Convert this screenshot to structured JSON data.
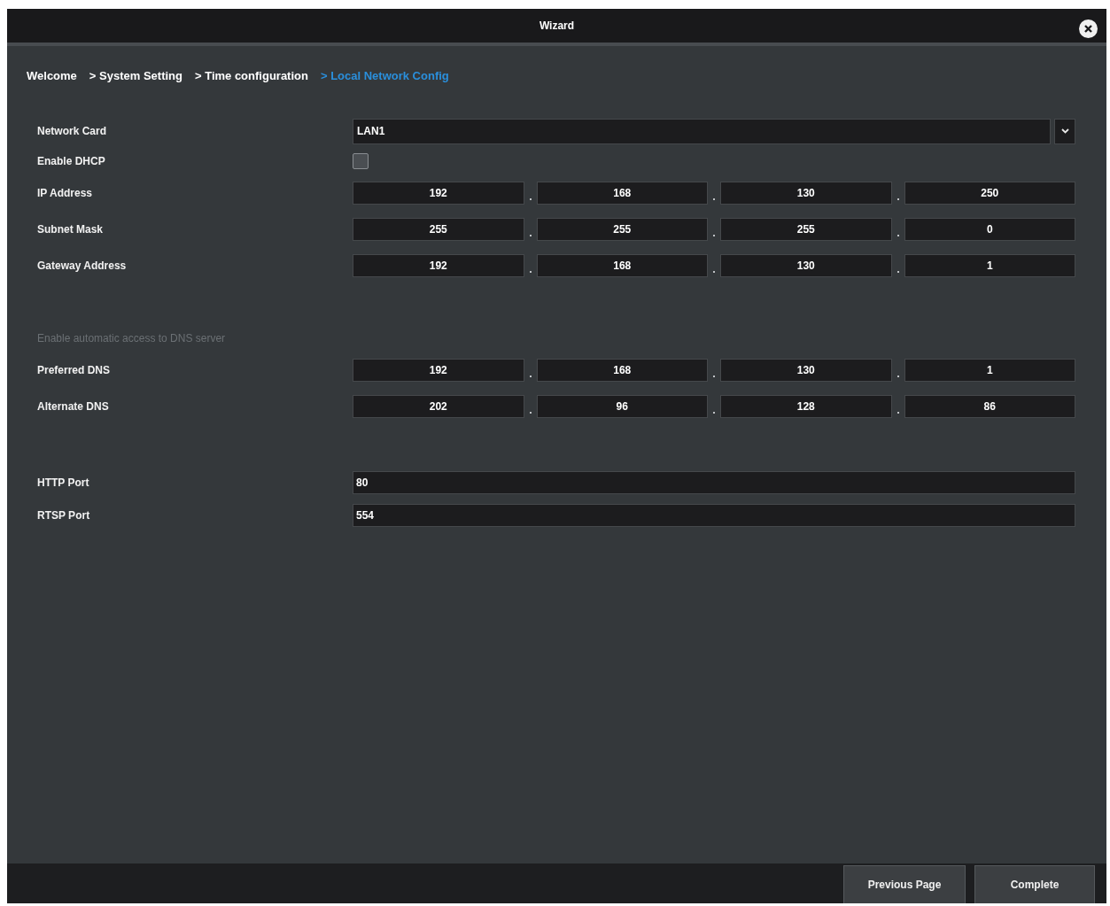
{
  "window": {
    "title": "Wizard"
  },
  "breadcrumb": [
    {
      "label": "Welcome",
      "selected": false
    },
    {
      "label": "> System Setting",
      "selected": false
    },
    {
      "label": "> Time configuration",
      "selected": false
    },
    {
      "label": "> Local Network Config",
      "selected": true
    }
  ],
  "groups": [
    {
      "rows": [
        {
          "kind": "select",
          "label": "Network Card",
          "value": "LAN1"
        },
        {
          "kind": "checkbox",
          "label": "Enable DHCP",
          "checked": false
        },
        {
          "kind": "ip",
          "label": "IP Address",
          "octets": [
            "192",
            "168",
            "130",
            "250"
          ]
        },
        {
          "kind": "ip",
          "label": "Subnet Mask",
          "octets": [
            "255",
            "255",
            "255",
            "0"
          ]
        },
        {
          "kind": "ip",
          "label": "Gateway Address",
          "octets": [
            "192",
            "168",
            "130",
            "1"
          ]
        }
      ]
    },
    {
      "rows": [
        {
          "kind": "note",
          "label": "Enable automatic access to DNS server",
          "disabled": true
        },
        {
          "kind": "ip",
          "label": "Preferred DNS",
          "octets": [
            "192",
            "168",
            "130",
            "1"
          ]
        },
        {
          "kind": "ip",
          "label": "Alternate DNS",
          "octets": [
            "202",
            "96",
            "128",
            "86"
          ]
        }
      ]
    },
    {
      "rows": [
        {
          "kind": "text",
          "label": "HTTP Port",
          "value": "80"
        },
        {
          "kind": "text",
          "label": "RTSP Port",
          "value": "554"
        }
      ]
    }
  ],
  "buttons": [
    {
      "label": "Previous Page"
    },
    {
      "label": "Complete"
    }
  ]
}
